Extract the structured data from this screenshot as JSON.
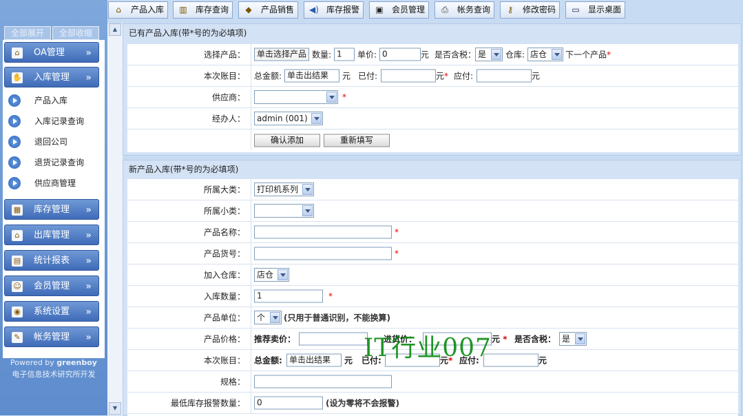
{
  "sidebar": {
    "expand_all": "全部展开",
    "collapse_all": "全部收缩",
    "sections": [
      {
        "label": "OA管理",
        "icon": "home-icon"
      },
      {
        "label": "入库管理",
        "icon": "hand-icon"
      },
      {
        "label": "库存管理",
        "icon": "blocks-icon"
      },
      {
        "label": "出库管理",
        "icon": "home-icon"
      },
      {
        "label": "统计报表",
        "icon": "report-icon"
      },
      {
        "label": "会员管理",
        "icon": "member-icon"
      },
      {
        "label": "系统设置",
        "icon": "globe-icon"
      },
      {
        "label": "帐务管理",
        "icon": "account-icon"
      }
    ],
    "sub_items": [
      "产品入库",
      "入库记录查询",
      "退回公司",
      "退货记录查询",
      "供应商管理"
    ],
    "chevron": "»",
    "powered_prefix": "Powered by ",
    "powered_brand": "greenboy",
    "credit": "电子信息技术研究所开发"
  },
  "toolbar": [
    {
      "label": "产品入库",
      "icon": "house-icon"
    },
    {
      "label": "库存查询",
      "icon": "book-icon"
    },
    {
      "label": "产品销售",
      "icon": "tag-icon"
    },
    {
      "label": "库存报警",
      "icon": "speaker-icon"
    },
    {
      "label": "会员管理",
      "icon": "card-icon"
    },
    {
      "label": "帐务查询",
      "icon": "printer-icon"
    },
    {
      "label": "修改密码",
      "icon": "key-icon"
    },
    {
      "label": "显示桌面",
      "icon": "desktop-icon"
    }
  ],
  "existing": {
    "title": "已有产品入库(带*号的为必填项)",
    "select_label": "选择产品：",
    "select_btn": "单击选择产品",
    "qty_label": "数量:",
    "qty_value": "1",
    "price_label": "单价:",
    "price_value": "0",
    "yuan": "元",
    "tax_label": "是否含税：",
    "tax_value": "是",
    "warehouse_label": "仓库:",
    "warehouse_value": "店仓",
    "next_label": "下一个产品",
    "account_label": "本次账目：",
    "total_label": "总金额:",
    "total_value": "单击出结果",
    "paid_label": "已付:",
    "due_label": "应付:",
    "supplier_label": "供应商：",
    "operator_label": "经办人：",
    "operator_value": "admin (001)",
    "confirm_btn": "确认添加",
    "reset_btn": "重新填写",
    "star": "*"
  },
  "newprod": {
    "title": "新产品入库(带*号的为必填项)",
    "category_label": "所属大类：",
    "category_value": "打印机系列",
    "subcategory_label": "所属小类：",
    "name_label": "产品名称：",
    "code_label": "产品货号：",
    "warehouse_label": "加入仓库：",
    "warehouse_value": "店仓",
    "qty_label": "入库数量：",
    "qty_value": "1",
    "unit_label": "产品单位：",
    "unit_value": "个",
    "unit_note": "(只用于普通识别，不能换算)",
    "price_label": "产品价格：",
    "suggest_label": "推荐卖价：",
    "purchase_label": "进货价：",
    "yuan": "元",
    "tax_label": "是否含税：",
    "tax_value": "是",
    "account_label": "本次账目：",
    "total_label": "总金额:",
    "total_value": "单击出结果",
    "paid_label": "已付:",
    "due_label": "应付:",
    "spec_label": "规格：",
    "min_stock_label": "最低库存报警数量：",
    "min_stock_value": "0",
    "min_stock_note": "(设为零将不会报警)",
    "star": "*"
  },
  "watermark": "IT行业007"
}
